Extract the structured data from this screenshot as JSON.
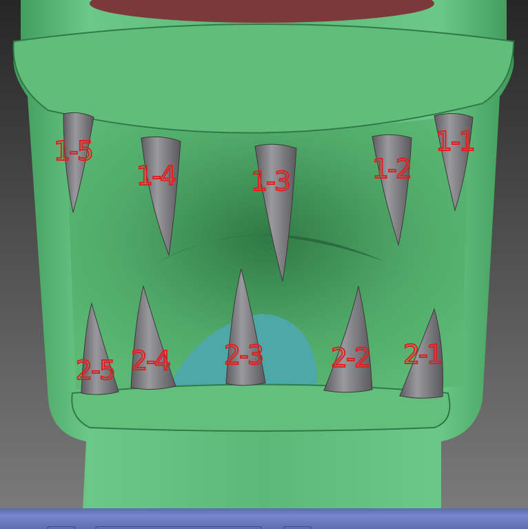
{
  "viewport": {
    "subject": "green creature mouth sculpt",
    "colors": {
      "skin": "#5fbf78",
      "skin_dark": "#2f7a45",
      "teeth": "#7b7b7e",
      "tongue": "#4fa8a8",
      "label": "#e02020",
      "top_red": "#7a3a3a",
      "bar": "#6a7bc4"
    }
  },
  "labels": {
    "upper": [
      "1-5",
      "1-4",
      "1-3",
      "1-2",
      "1-1"
    ],
    "lower": [
      "2-5",
      "2-4",
      "2-3",
      "2-2",
      "2-1"
    ]
  }
}
